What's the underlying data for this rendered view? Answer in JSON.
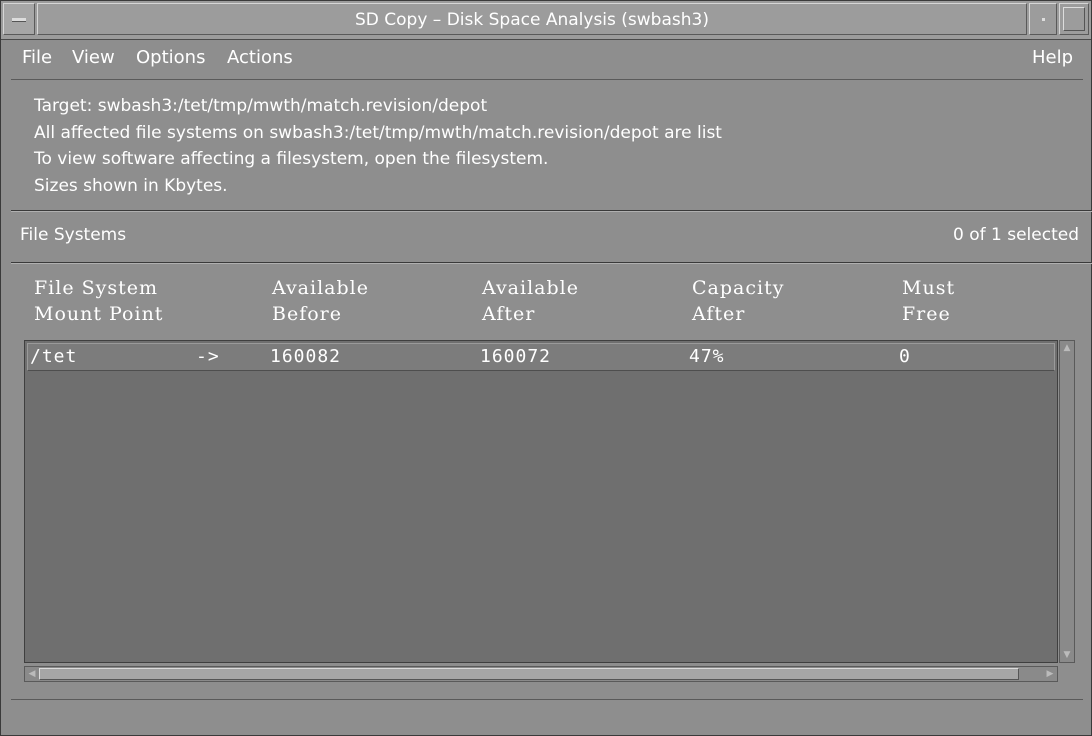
{
  "window": {
    "title": "SD Copy – Disk Space Analysis (swbash3)"
  },
  "menubar": {
    "items": [
      {
        "label": "File"
      },
      {
        "label": "View"
      },
      {
        "label": "Options"
      },
      {
        "label": "Actions"
      }
    ],
    "help": "Help"
  },
  "info": {
    "lines": [
      "Target:  swbash3:/tet/tmp/mwth/match.revision/depot",
      "All affected file systems on swbash3:/tet/tmp/mwth/match.revision/depot are list",
      "To view software affecting a filesystem, open the filesystem.",
      "Sizes shown in Kbytes."
    ]
  },
  "filesystems": {
    "label": "File Systems",
    "selection": "0 of 1 selected",
    "columns": [
      {
        "line1": "File System",
        "line2": "Mount Point"
      },
      {
        "line1": "Available",
        "line2": "Before"
      },
      {
        "line1": "Available",
        "line2": "After"
      },
      {
        "line1": "Capacity",
        "line2": "After"
      },
      {
        "line1": "Must",
        "line2": "Free"
      }
    ],
    "rows": [
      {
        "mount": "/tet",
        "arrow": "->",
        "avail_before": "160082",
        "avail_after": "160072",
        "capacity_after": "47%",
        "must_free": "0"
      }
    ]
  }
}
